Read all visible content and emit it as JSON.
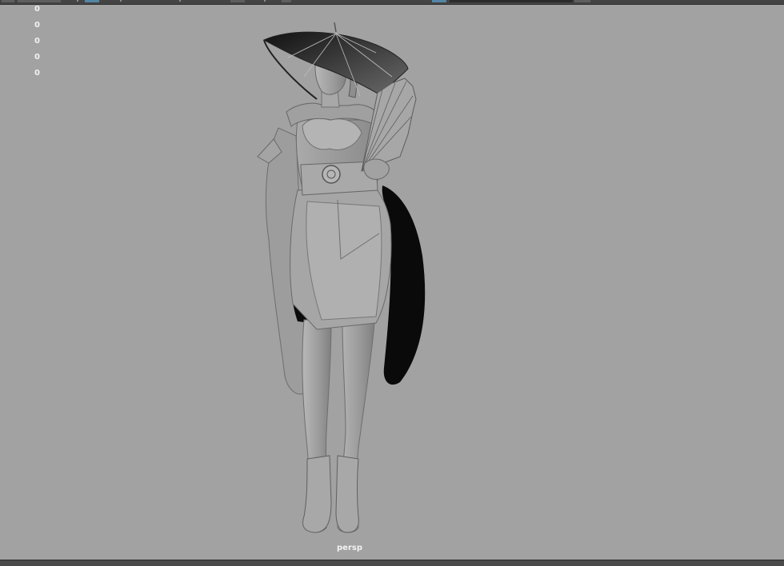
{
  "hud": {
    "values": [
      "0",
      "0",
      "0",
      "0",
      "0"
    ]
  },
  "viewport": {
    "camera_label": "persp"
  },
  "colors": {
    "viewport_background": "#a2a2a2",
    "toolbar_background": "#444444",
    "active_button": "#5285a6",
    "model_shade": "#9c9c9c",
    "hud_text": "#f2f2f2"
  }
}
